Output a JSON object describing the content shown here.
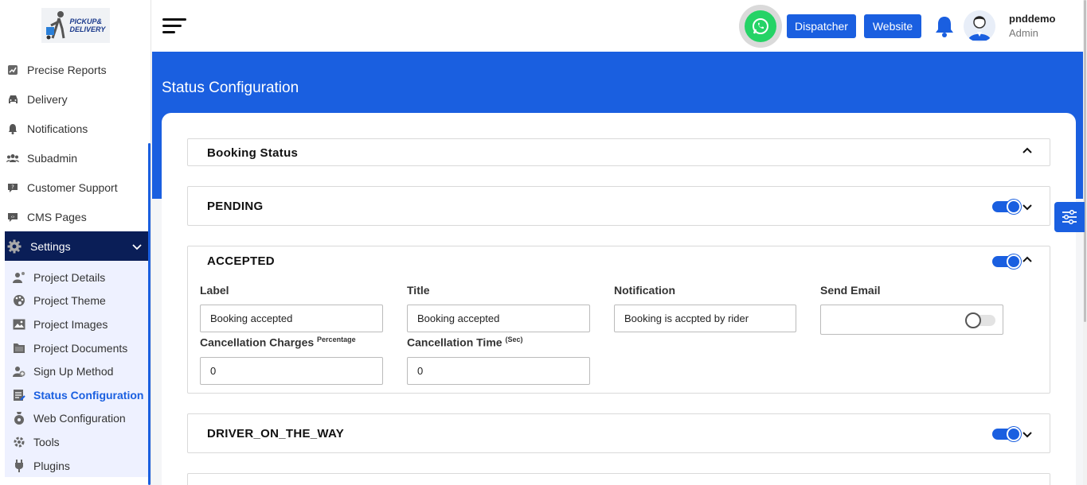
{
  "logo": {
    "text_line1": "PICKUP&",
    "text_line2": "DELIVERY"
  },
  "sidebar": {
    "items": [
      {
        "label": "Precise Reports",
        "icon": "chart-icon"
      },
      {
        "label": "Delivery",
        "icon": "car-icon"
      },
      {
        "label": "Notifications",
        "icon": "bell-icon"
      },
      {
        "label": "Subadmin",
        "icon": "users-icon"
      },
      {
        "label": "Customer Support",
        "icon": "support-icon"
      },
      {
        "label": "CMS Pages",
        "icon": "chat-icon"
      }
    ],
    "settings": {
      "label": "Settings",
      "icon": "gear-icon"
    },
    "sub_items": [
      {
        "label": "Project Details",
        "icon": "user-gear-icon"
      },
      {
        "label": "Project Theme",
        "icon": "palette-icon"
      },
      {
        "label": "Project Images",
        "icon": "image-icon"
      },
      {
        "label": "Project Documents",
        "icon": "documents-icon"
      },
      {
        "label": "Sign Up Method",
        "icon": "user-plus-icon"
      },
      {
        "label": "Status Configuration",
        "icon": "status-icon"
      },
      {
        "label": "Web Configuration",
        "icon": "web-config-icon"
      },
      {
        "label": "Tools",
        "icon": "tools-icon"
      },
      {
        "label": "Plugins",
        "icon": "plug-icon"
      }
    ]
  },
  "header": {
    "dispatcher_label": "Dispatcher",
    "website_label": "Website",
    "user_name": "pnddemo",
    "user_role": "Admin"
  },
  "page": {
    "title": "Status Configuration"
  },
  "sections": {
    "booking_status": "Booking Status",
    "pending": "PENDING",
    "accepted": "ACCEPTED",
    "driver_on_the_way": "DRIVER_ON_THE_WAY"
  },
  "accepted_form": {
    "label_label": "Label",
    "label_value": "Booking accepted",
    "title_label": "Title",
    "title_value": "Booking accepted",
    "notification_label": "Notification",
    "notification_value": "Booking is accpted by rider",
    "send_email_label": "Send Email",
    "send_email_enabled": false,
    "cancellation_charges_label": "Cancellation Charges",
    "cancellation_charges_sup": "Percentage",
    "cancellation_charges_value": "0",
    "cancellation_time_label": "Cancellation Time",
    "cancellation_time_sup": "(Sec)",
    "cancellation_time_value": "0"
  },
  "toggles": {
    "pending": true,
    "accepted": true,
    "driver_on_the_way": true
  },
  "colors": {
    "primary": "#1a5fe0",
    "sidebar_active_bg": "#0a1e57",
    "whatsapp": "#25d366"
  }
}
